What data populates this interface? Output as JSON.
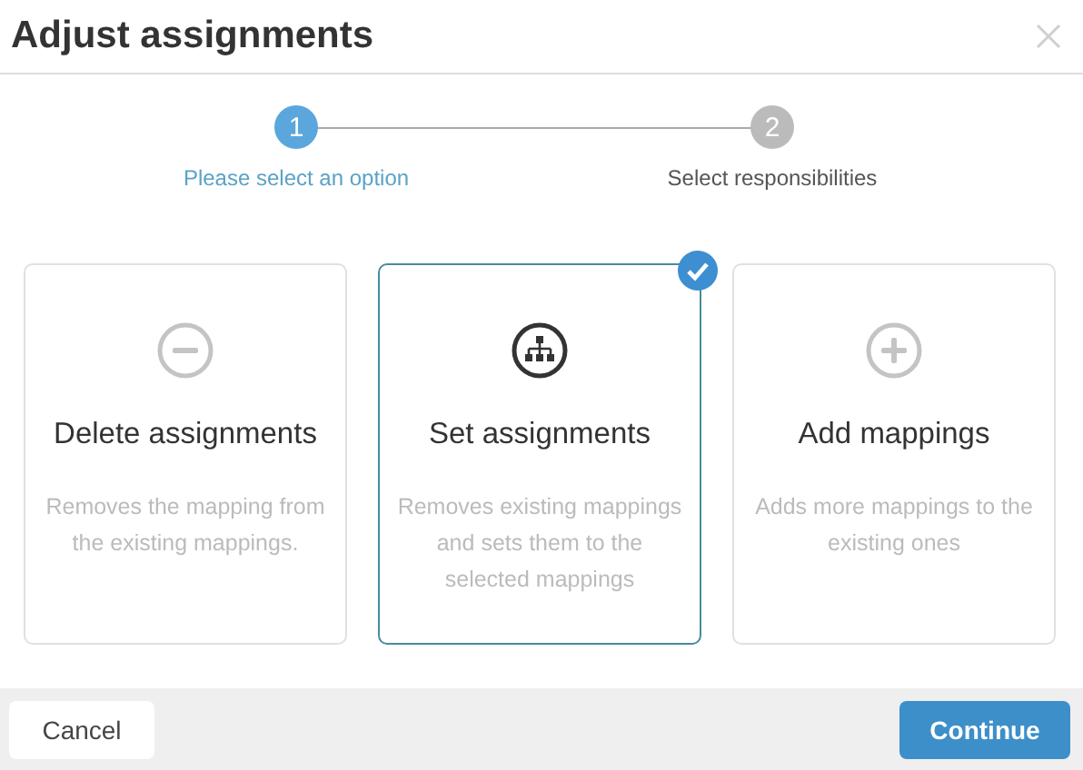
{
  "dialog": {
    "title": "Adjust assignments"
  },
  "steps": [
    {
      "number": "1",
      "label": "Please select an option",
      "selected": true
    },
    {
      "number": "2",
      "label": "Select responsibilities",
      "selected": false
    }
  ],
  "options": [
    {
      "kind": "remove",
      "title": "Delete assignments",
      "description": "Removes the mapping from the existing mappings.",
      "selected": false
    },
    {
      "kind": "hierarchy",
      "title": "Set assignments",
      "description": "Removes existing mappings and sets them to the selected mappings",
      "selected": true
    },
    {
      "kind": "add",
      "title": "Add mappings",
      "description": "Adds more mappings to the existing ones",
      "selected": false
    }
  ],
  "buttons": {
    "cancel": "Cancel",
    "continue": "Continue"
  }
}
